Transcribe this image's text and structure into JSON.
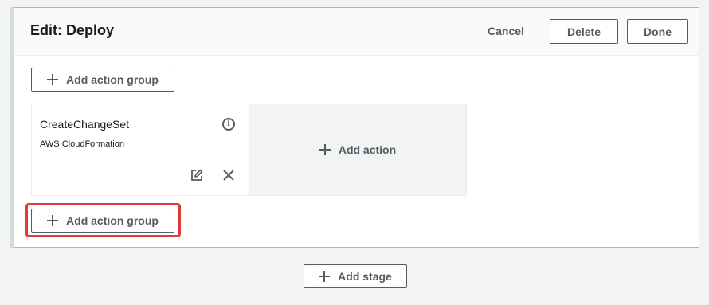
{
  "stage": {
    "title": "Edit: Deploy",
    "cancel_label": "Cancel",
    "delete_label": "Delete",
    "done_label": "Done"
  },
  "add_action_group_label": "Add action group",
  "action_group": {
    "action": {
      "name": "CreateChangeSet",
      "provider": "AWS CloudFormation",
      "info_icon": "info-icon",
      "edit_icon": "edit-icon",
      "remove_icon": "close-icon"
    },
    "add_action_label": "Add action"
  },
  "add_stage_label": "Add stage",
  "colors": {
    "highlight": "#e03b3b",
    "button_border": "#545b64",
    "background": "#f2f3f3"
  }
}
